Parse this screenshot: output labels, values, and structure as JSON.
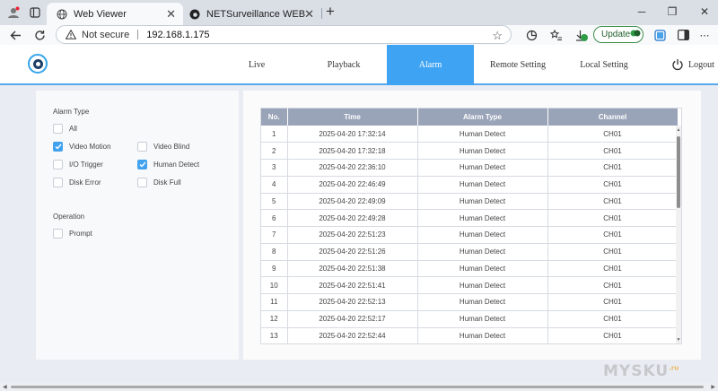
{
  "browser": {
    "tabs": [
      {
        "title": "Web Viewer",
        "icon": "globe-icon",
        "active": true
      },
      {
        "title": "NETSurveillance WEB",
        "icon": "edge-icon",
        "active": false
      }
    ],
    "address": {
      "security_label": "Not secure",
      "url": "192.168.1.175"
    },
    "update_label": "Update"
  },
  "nav": {
    "items": [
      {
        "label": "Live",
        "active": false
      },
      {
        "label": "Playback",
        "active": false
      },
      {
        "label": "Alarm",
        "active": true
      },
      {
        "label": "Remote Setting",
        "active": false
      },
      {
        "label": "Local Setting",
        "active": false
      }
    ],
    "logout_label": "Logout",
    "accent": "#3ea3f2"
  },
  "filters": {
    "alarm_type_title": "Alarm Type",
    "all_label": "All",
    "video_motion_label": "Video Motion",
    "video_blind_label": "Video Blind",
    "io_trigger_label": "I/O Trigger",
    "human_detect_label": "Human Detect",
    "disk_error_label": "Disk Error",
    "disk_full_label": "Disk Full",
    "operation_title": "Operation",
    "prompt_label": "Prompt",
    "checked": {
      "all": false,
      "video_motion": true,
      "video_blind": false,
      "io_trigger": false,
      "human_detect": true,
      "disk_error": false,
      "disk_full": false,
      "prompt": false
    }
  },
  "table": {
    "headers": {
      "no": "No.",
      "time": "Time",
      "type": "Alarm Type",
      "channel": "Channel"
    },
    "rows": [
      {
        "no": "1",
        "time": "2025-04-20 17:32:14",
        "type": "Human Detect",
        "channel": "CH01"
      },
      {
        "no": "2",
        "time": "2025-04-20 17:32:18",
        "type": "Human Detect",
        "channel": "CH01"
      },
      {
        "no": "3",
        "time": "2025-04-20 22:36:10",
        "type": "Human Detect",
        "channel": "CH01"
      },
      {
        "no": "4",
        "time": "2025-04-20 22:46:49",
        "type": "Human Detect",
        "channel": "CH01"
      },
      {
        "no": "5",
        "time": "2025-04-20 22:49:09",
        "type": "Human Detect",
        "channel": "CH01"
      },
      {
        "no": "6",
        "time": "2025-04-20 22:49:28",
        "type": "Human Detect",
        "channel": "CH01"
      },
      {
        "no": "7",
        "time": "2025-04-20 22:51:23",
        "type": "Human Detect",
        "channel": "CH01"
      },
      {
        "no": "8",
        "time": "2025-04-20 22:51:26",
        "type": "Human Detect",
        "channel": "CH01"
      },
      {
        "no": "9",
        "time": "2025-04-20 22:51:38",
        "type": "Human Detect",
        "channel": "CH01"
      },
      {
        "no": "10",
        "time": "2025-04-20 22:51:41",
        "type": "Human Detect",
        "channel": "CH01"
      },
      {
        "no": "11",
        "time": "2025-04-20 22:52:13",
        "type": "Human Detect",
        "channel": "CH01"
      },
      {
        "no": "12",
        "time": "2025-04-20 22:52:17",
        "type": "Human Detect",
        "channel": "CH01"
      },
      {
        "no": "13",
        "time": "2025-04-20 22:52:44",
        "type": "Human Detect",
        "channel": "CH01"
      }
    ]
  },
  "watermark": {
    "text": "MYSKU",
    "sup": ".ru"
  }
}
